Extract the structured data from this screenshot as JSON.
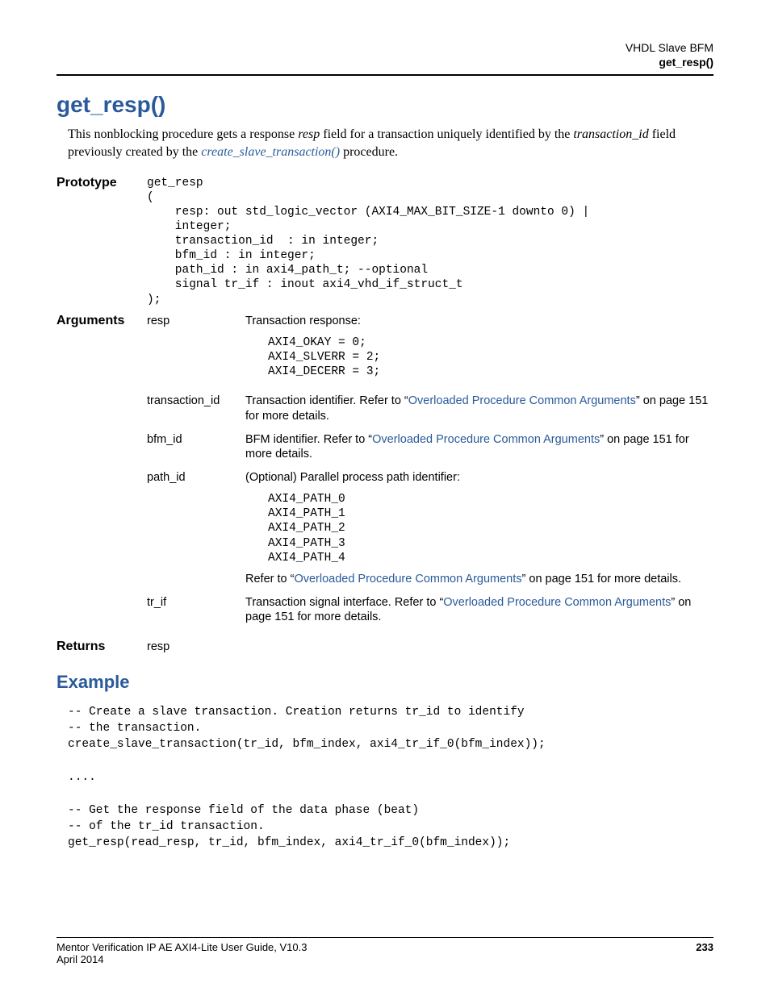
{
  "header": {
    "line1": "VHDL Slave BFM",
    "line2": "get_resp()"
  },
  "title": "get_resp()",
  "intro": {
    "part1": "This nonblocking procedure gets a response ",
    "ital1": "resp",
    "part2": " field for a transaction uniquely identified by the ",
    "ital2": "transaction_id",
    "part3": " field previously created by the ",
    "link": "create_slave_transaction()",
    "part4": " procedure."
  },
  "prototype": {
    "label": "Prototype",
    "code": "get_resp\n(\n    resp: out std_logic_vector (AXI4_MAX_BIT_SIZE-1 downto 0) |\n    integer;\n    transaction_id  : in integer;\n    bfm_id : in integer;\n    path_id : in axi4_path_t; --optional\n    signal tr_if : inout axi4_vhd_if_struct_t\n);"
  },
  "arguments": {
    "label": "Arguments",
    "rows": [
      {
        "name": "resp",
        "desc_pre": "Transaction response:",
        "vals": "AXI4_OKAY = 0;\nAXI4_SLVERR = 2;\nAXI4_DECERR = 3;"
      },
      {
        "name": "transaction_id",
        "desc_pre": "Transaction identifier. Refer to “",
        "link": "Overloaded Procedure Common Arguments",
        "desc_post": "” on page 151 for more details."
      },
      {
        "name": "bfm_id",
        "desc_pre": "BFM identifier. Refer to “",
        "link": "Overloaded Procedure Common Arguments",
        "desc_post": "” on page 151 for more details."
      },
      {
        "name": "path_id",
        "desc_pre": "(Optional) Parallel process path identifier:",
        "vals": "AXI4_PATH_0\nAXI4_PATH_1\nAXI4_PATH_2\nAXI4_PATH_3\nAXI4_PATH_4",
        "desc_post_pre": "Refer to “",
        "link": "Overloaded Procedure Common Arguments",
        "desc_post_post": "” on page 151 for more details."
      },
      {
        "name": "tr_if",
        "desc_pre": "Transaction signal interface. Refer to “",
        "link": "Overloaded Procedure Common Arguments",
        "desc_post": "” on page 151 for more details."
      }
    ]
  },
  "returns": {
    "label": "Returns",
    "value": "resp"
  },
  "example": {
    "title": "Example",
    "code": "-- Create a slave transaction. Creation returns tr_id to identify\n-- the transaction.\ncreate_slave_transaction(tr_id, bfm_index, axi4_tr_if_0(bfm_index));\n\n....\n\n-- Get the response field of the data phase (beat)\n-- of the tr_id transaction.\nget_resp(read_resp, tr_id, bfm_index, axi4_tr_if_0(bfm_index));"
  },
  "footer": {
    "left1": "Mentor Verification IP AE AXI4-Lite User Guide, V10.3",
    "left2": "April 2014",
    "page": "233"
  }
}
